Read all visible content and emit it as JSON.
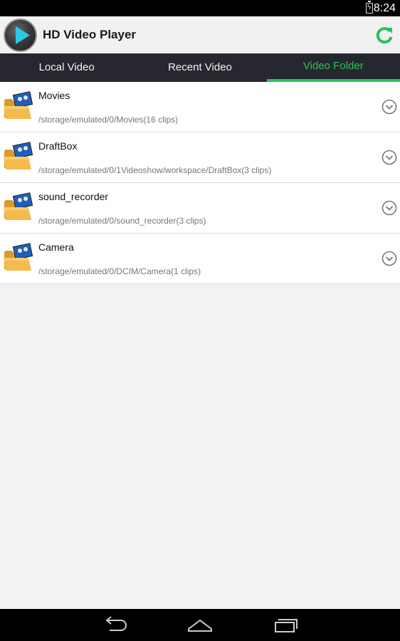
{
  "status": {
    "time": "8:24"
  },
  "app": {
    "title": "HD Video Player"
  },
  "tabs": [
    {
      "label": "Local Video"
    },
    {
      "label": "Recent Video"
    },
    {
      "label": "Video Folder"
    }
  ],
  "folders": [
    {
      "name": "Movies",
      "path": "/storage/emulated/0/Movies(16 clips)"
    },
    {
      "name": "DraftBox",
      "path": "/storage/emulated/0/1Videoshow/workspace/DraftBox(3 clips)"
    },
    {
      "name": "sound_recorder",
      "path": "/storage/emulated/0/sound_recorder(3 clips)"
    },
    {
      "name": "Camera",
      "path": "/storage/emulated/0/DCIM/Camera(1 clips)"
    }
  ],
  "icons": {
    "app_logo": "play-icon",
    "refresh": "refresh-icon",
    "folder": "video-folder-icon",
    "expand": "chevron-down-circle-icon",
    "nav_back": "back-icon",
    "nav_home": "home-icon",
    "nav_recents": "recents-icon"
  },
  "colors": {
    "accent": "#27c15c",
    "tab_bar": "#27282f",
    "play": "#2ec8e6"
  }
}
